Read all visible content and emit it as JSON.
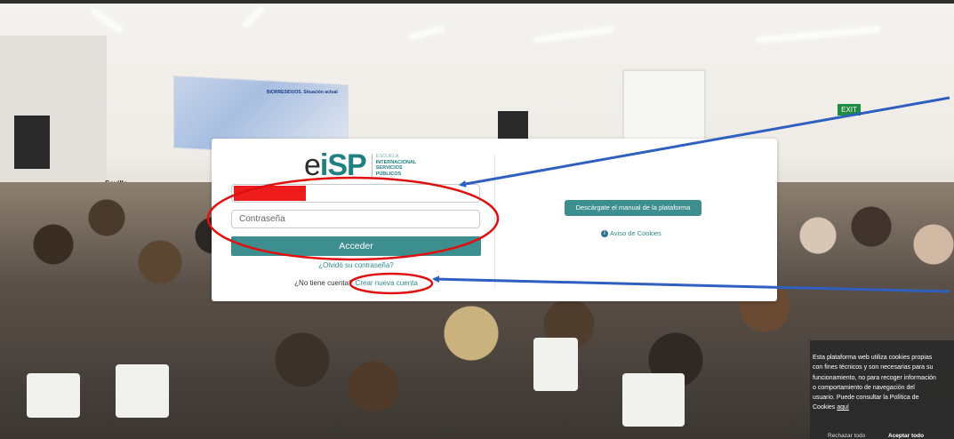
{
  "login": {
    "logo_mark": "eiSP",
    "logo_lines": [
      "ESCUELA",
      "INTERNACIONAL",
      "SERVICIOS",
      "PÚBLICOS"
    ],
    "username_value": "",
    "password_placeholder": "Contraseña",
    "submit_label": "Acceder",
    "forgot_label": "¿Olvidó su contraseña?",
    "no_account_text": "¿No tiene cuenta?",
    "create_account_label": "Crear nueva cuenta"
  },
  "side": {
    "manual_button_label": "Descárgate el manual de la plataforma",
    "cookie_notice_label": "Aviso de Cookies"
  },
  "background": {
    "projector_title": "BIORRESIDUOS. Situación actual",
    "podium_text": "Sevilla",
    "exit_sign": "EXIT"
  },
  "cookie_banner": {
    "lines": [
      "Esta plataforma web utiliza cookies propias",
      "con fines técnicos y son necesarias para su",
      "funcionamiento, no para recoger información",
      "o comportamiento de navegación del",
      "usuario. Puede consultar la Política de"
    ],
    "last_line_prefix": "Cookies",
    "here_link": "aquí",
    "reject_label": "Rechazar todo",
    "accept_label": "Aceptar todo"
  },
  "colors": {
    "accent": "#3d8e8e",
    "annotation_red": "#e01010",
    "annotation_blue": "#2f5fbf",
    "redaction": "#ee1c1c"
  }
}
